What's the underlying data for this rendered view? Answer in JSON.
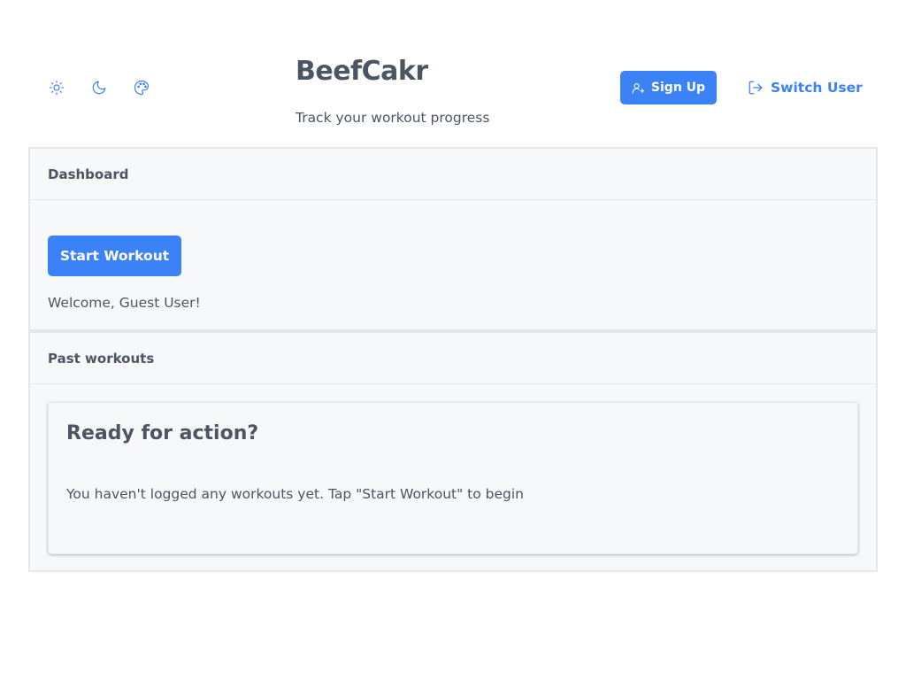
{
  "header": {
    "app_title": "BeefCakr",
    "app_subtitle": "Track your workout progress",
    "theme_icons": [
      "sun-icon",
      "moon-icon",
      "palette-icon"
    ],
    "signup_label": "Sign Up",
    "switch_user_label": "Switch User"
  },
  "dashboard": {
    "heading": "Dashboard",
    "start_workout_label": "Start Workout",
    "welcome_text": "Welcome, Guest User!"
  },
  "past_workouts": {
    "heading": "Past workouts",
    "empty_title": "Ready for action?",
    "empty_text": "You haven't logged any workouts yet. Tap \"Start Workout\" to begin"
  },
  "colors": {
    "accent": "#3b82f6",
    "text": "#4b5563",
    "panel_bg": "#f7f8f9",
    "border": "#e5e7eb"
  }
}
